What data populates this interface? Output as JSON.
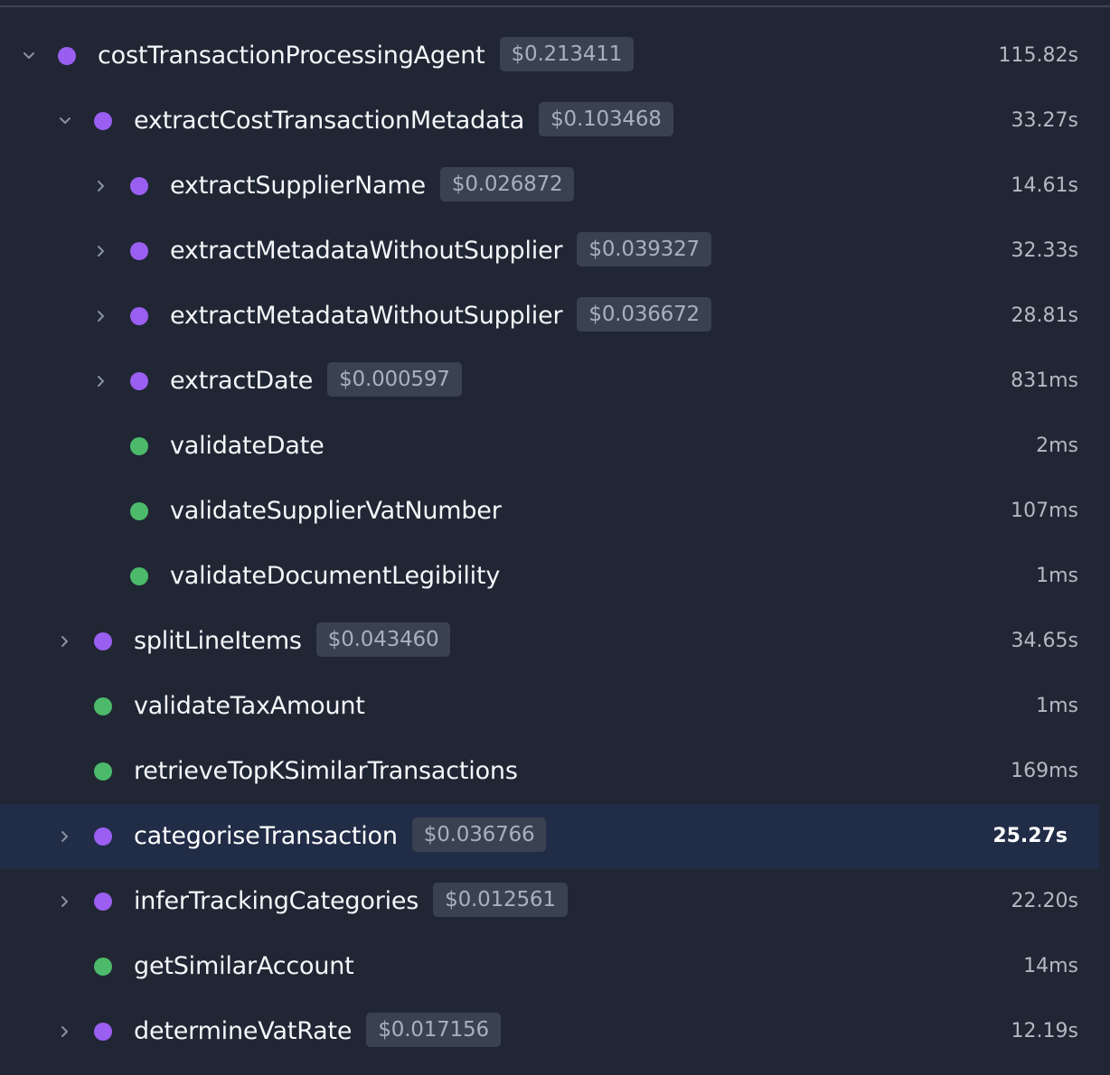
{
  "colors": {
    "llm_span": "#9a5ff0",
    "function_span": "#4cba6a",
    "chevron": "#8a92a0"
  },
  "spans": [
    {
      "name": "costTransactionProcessingAgent",
      "cost": "$0.213411",
      "duration": "115.82s",
      "kind": "llm",
      "depth": 0,
      "chevron": "expanded"
    },
    {
      "name": "extractCostTransactionMetadata",
      "cost": "$0.103468",
      "duration": "33.27s",
      "kind": "llm",
      "depth": 1,
      "chevron": "expanded"
    },
    {
      "name": "extractSupplierName",
      "cost": "$0.026872",
      "duration": "14.61s",
      "kind": "llm",
      "depth": 2,
      "chevron": "collapsed"
    },
    {
      "name": "extractMetadataWithoutSupplier",
      "cost": "$0.039327",
      "duration": "32.33s",
      "kind": "llm",
      "depth": 2,
      "chevron": "collapsed"
    },
    {
      "name": "extractMetadataWithoutSupplier",
      "cost": "$0.036672",
      "duration": "28.81s",
      "kind": "llm",
      "depth": 2,
      "chevron": "collapsed"
    },
    {
      "name": "extractDate",
      "cost": "$0.000597",
      "duration": "831ms",
      "kind": "llm",
      "depth": 2,
      "chevron": "collapsed"
    },
    {
      "name": "validateDate",
      "cost": null,
      "duration": "2ms",
      "kind": "function",
      "depth": 2,
      "chevron": "none"
    },
    {
      "name": "validateSupplierVatNumber",
      "cost": null,
      "duration": "107ms",
      "kind": "function",
      "depth": 2,
      "chevron": "none"
    },
    {
      "name": "validateDocumentLegibility",
      "cost": null,
      "duration": "1ms",
      "kind": "function",
      "depth": 2,
      "chevron": "none"
    },
    {
      "name": "splitLineItems",
      "cost": "$0.043460",
      "duration": "34.65s",
      "kind": "llm",
      "depth": 1,
      "chevron": "collapsed"
    },
    {
      "name": "validateTaxAmount",
      "cost": null,
      "duration": "1ms",
      "kind": "function",
      "depth": 1,
      "chevron": "none"
    },
    {
      "name": "retrieveTopKSimilarTransactions",
      "cost": null,
      "duration": "169ms",
      "kind": "function",
      "depth": 1,
      "chevron": "none"
    },
    {
      "name": "categoriseTransaction",
      "cost": "$0.036766",
      "duration": "25.27s",
      "kind": "llm",
      "depth": 1,
      "chevron": "collapsed",
      "selected": true
    },
    {
      "name": "inferTrackingCategories",
      "cost": "$0.012561",
      "duration": "22.20s",
      "kind": "llm",
      "depth": 1,
      "chevron": "collapsed"
    },
    {
      "name": "getSimilarAccount",
      "cost": null,
      "duration": "14ms",
      "kind": "function",
      "depth": 1,
      "chevron": "none"
    },
    {
      "name": "determineVatRate",
      "cost": "$0.017156",
      "duration": "12.19s",
      "kind": "llm",
      "depth": 1,
      "chevron": "collapsed"
    }
  ]
}
